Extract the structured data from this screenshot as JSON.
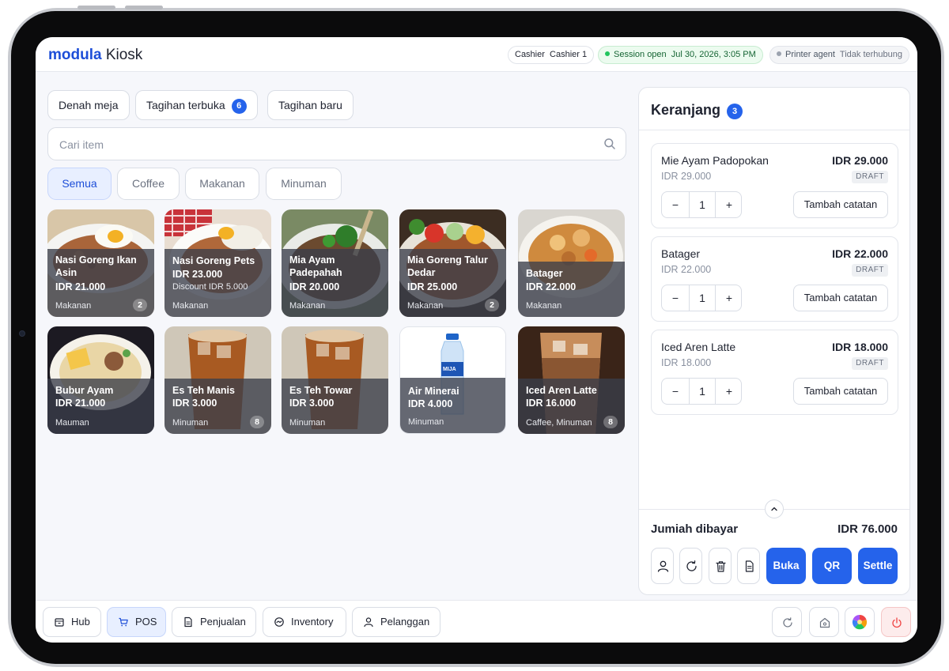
{
  "header": {
    "brand_primary": "modula",
    "brand_secondary": "Kiosk",
    "cashier_label": "Cashier",
    "cashier_value": "Cashier 1",
    "session_label": "Session open",
    "session_time": "Jul 30, 2026, 3:05 PM",
    "printer_label": "Printer agent",
    "printer_status": "Tidak terhubung"
  },
  "tabs": {
    "table_map": "Denah meja",
    "open_bills": "Tagihan terbuka",
    "open_bills_count": "6",
    "new_bill": "Tagihan baru"
  },
  "search": {
    "placeholder": "Cari item"
  },
  "categories": [
    "Semua",
    "Coffee",
    "Makanan",
    "Minuman"
  ],
  "products": [
    {
      "name_l1": "Nasi Goreng Ikan",
      "name_l2": "Asin",
      "price": "IDR 21.000",
      "category": "Makanan",
      "count": "2"
    },
    {
      "name_l1": "Nasi Goreng Pets",
      "name_l2": "",
      "price": "IDR 23.000",
      "discount": "Discount  IDR 5.000",
      "category": "Makanan",
      "count": ""
    },
    {
      "name_l1": "Mia Ayam",
      "name_l2": "Padepahah",
      "price": "IDR 20.000",
      "category": "Makanan",
      "count": ""
    },
    {
      "name_l1": "Mia Goreng Talur",
      "name_l2": "Dedar",
      "price": "IDR 25.000",
      "category": "Makanan",
      "count": "2"
    },
    {
      "name_l1": "Batager",
      "name_l2": "",
      "price": "IDR 22.000",
      "category": "Makanan",
      "count": ""
    },
    {
      "name_l1": "Bubur Ayam",
      "name_l2": "",
      "price": "IDR 21.000",
      "category": "Mauman",
      "count": ""
    },
    {
      "name_l1": "Es Teh Manis",
      "name_l2": "",
      "price": "IDR 3.000",
      "category": "Minuman",
      "count": "8"
    },
    {
      "name_l1": "Es Teh Towar",
      "name_l2": "",
      "price": "IDR 3.000",
      "category": "Minuman",
      "count": ""
    },
    {
      "name_l1": "Air Minerai",
      "name_l2": "",
      "price": "IDR 4.000",
      "category": "Minuman",
      "count": "",
      "bottle_label": "MIJA"
    },
    {
      "name_l1": "Iced Aren Latte",
      "name_l2": "",
      "price": "IDR 16.000",
      "category": "Caffee, Minuman",
      "count": "8"
    }
  ],
  "cart": {
    "title": "Keranjang",
    "count": "3",
    "items": [
      {
        "name": "Mie Ayam Padopokan",
        "price": "IDR 29.000",
        "unit": "IDR 29.000",
        "status": "DRAFT",
        "qty": "1",
        "note_label": "Tambah catatan"
      },
      {
        "name": "Batager",
        "price": "IDR 22.000",
        "unit": "IDR 22.000",
        "status": "DRAFT",
        "qty": "1",
        "note_label": "Tambah catatan"
      },
      {
        "name": "Iced Aren Latte",
        "price": "IDR 18.000",
        "unit": "IDR 18.000",
        "status": "DRAFT",
        "qty": "1",
        "note_label": "Tambah catatan"
      }
    ],
    "minus": "−",
    "plus": "+",
    "total_label": "Jumiah dibayar",
    "total_value": "IDR 76.000",
    "actions": {
      "open": "Buka",
      "qr": "QR",
      "settle": "Settle"
    }
  },
  "bottom_nav": [
    "Hub",
    "POS",
    "Penjualan",
    "Inventory",
    "Pelanggan"
  ],
  "colors": {
    "accent": "#2563eb",
    "brand": "#1d4ed8",
    "session_green": "#22c55e"
  }
}
